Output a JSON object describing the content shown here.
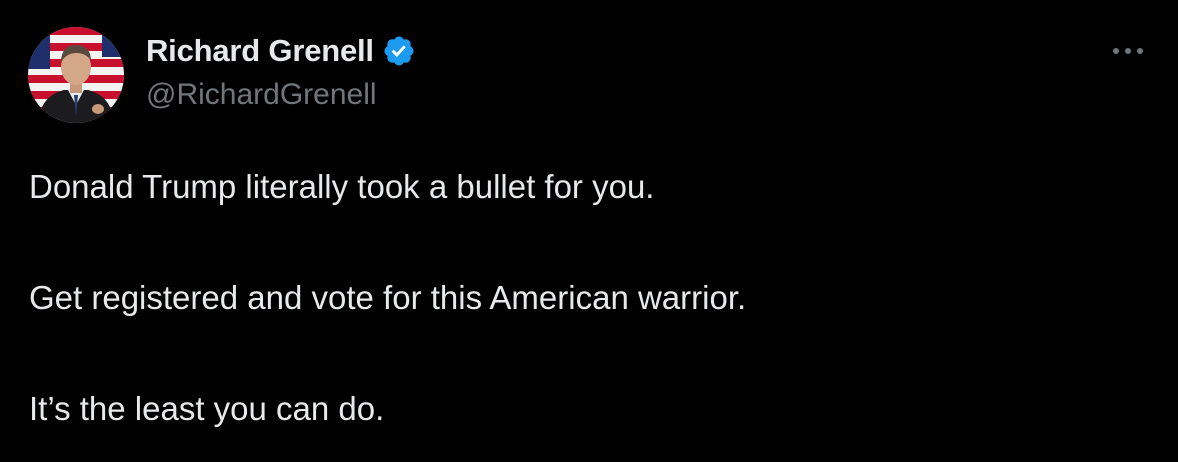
{
  "author": {
    "display_name": "Richard Grenell",
    "handle": "@RichardGrenell",
    "verified": true,
    "verified_badge_color": "#1d9bf0",
    "avatar_icon": "profile-photo"
  },
  "menu": {
    "icon": "more-horizontal-icon"
  },
  "tweet": {
    "paragraphs": [
      "Donald Trump literally took a bullet for you.",
      "Get registered and vote for this American warrior.",
      "It’s the least you can do."
    ]
  },
  "colors": {
    "background": "#000000",
    "text_primary": "#e7e9ea",
    "text_secondary": "#71767b",
    "accent": "#1d9bf0"
  }
}
